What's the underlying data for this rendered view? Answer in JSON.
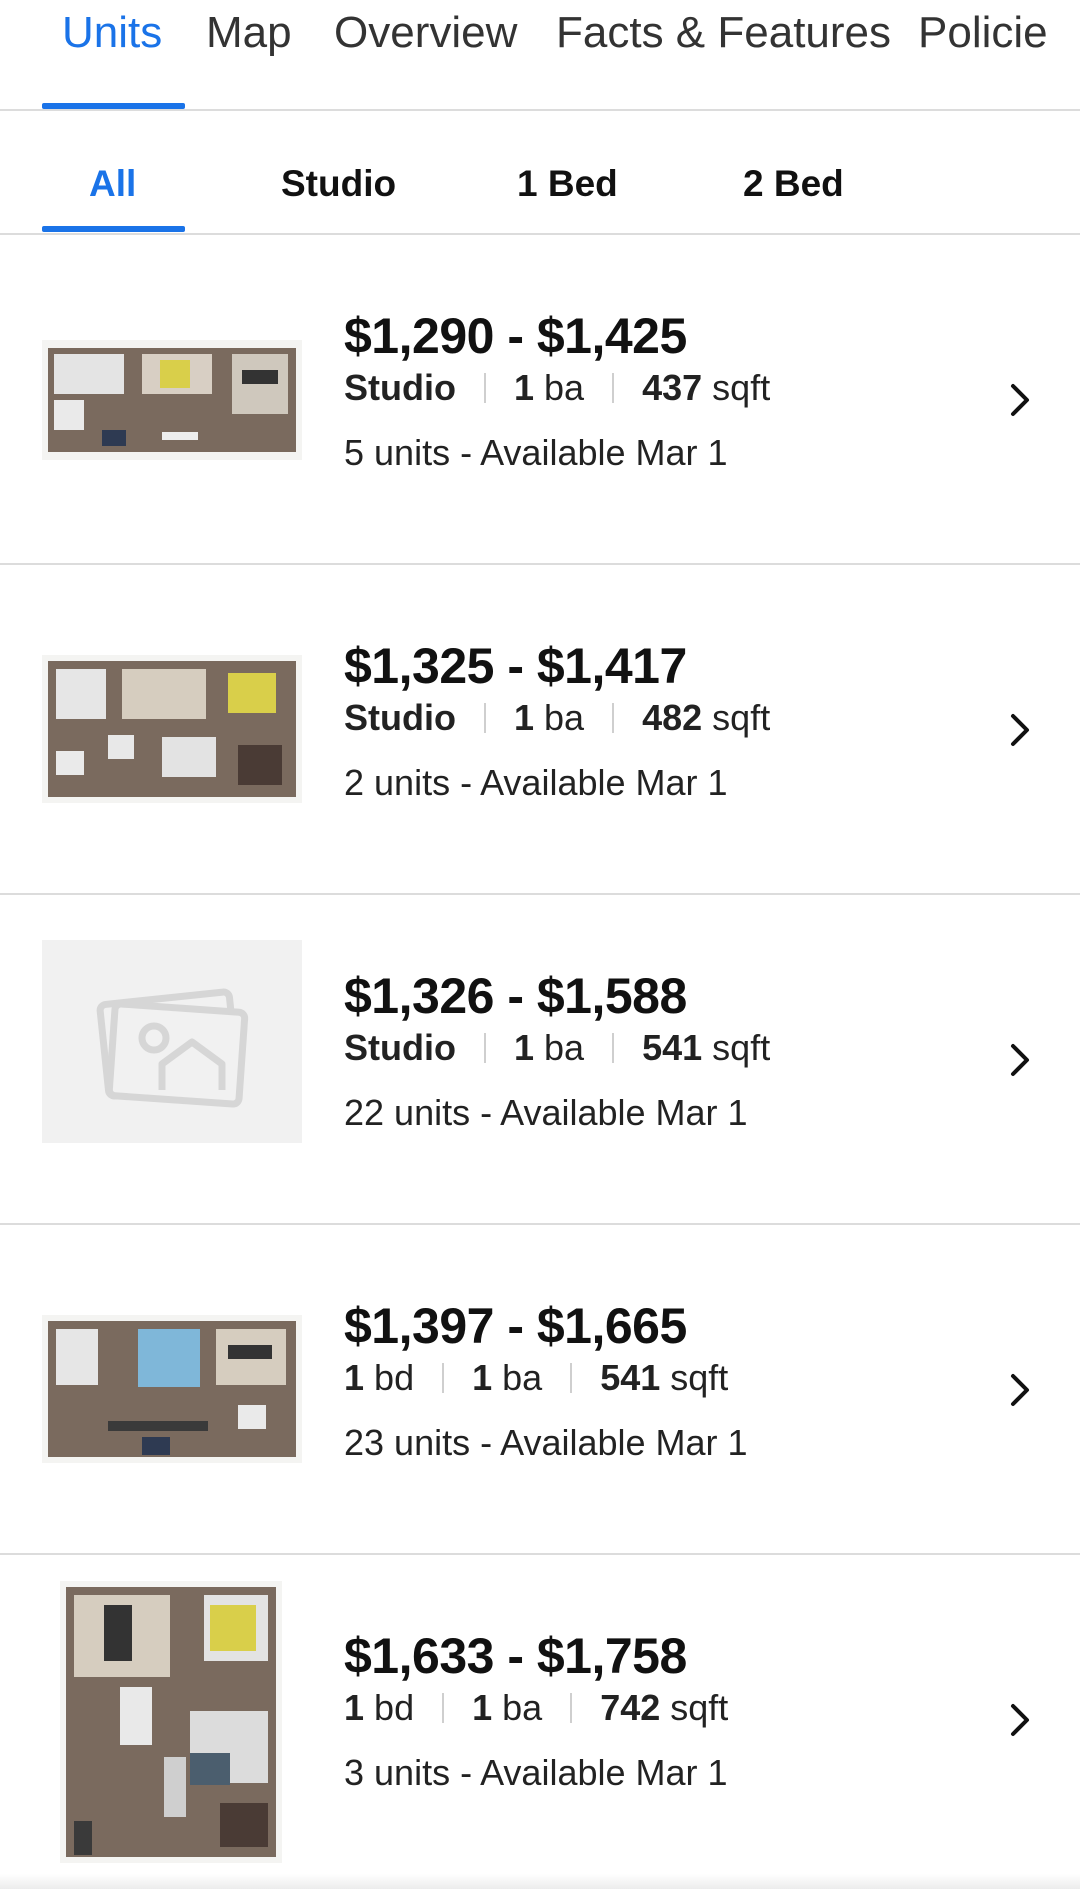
{
  "top_tabs": [
    "Units",
    "Map",
    "Overview",
    "Facts & Features",
    "Policie"
  ],
  "bed_tabs": [
    "All",
    "Studio",
    "1 Bed",
    "2 Bed"
  ],
  "colors": {
    "accent": "#1a73e8",
    "divider": "#dcdcdc",
    "text": "#111111"
  },
  "units": [
    {
      "price": "$1,290 - $1,425",
      "beds_value": "Studio",
      "beds_unit": "",
      "baths_value": "1",
      "baths_unit": "ba",
      "sqft_value": "437",
      "sqft_unit": "sqft",
      "availability": "5 units - Available Mar 1",
      "thumbnail": "floorplan"
    },
    {
      "price": "$1,325 - $1,417",
      "beds_value": "Studio",
      "beds_unit": "",
      "baths_value": "1",
      "baths_unit": "ba",
      "sqft_value": "482",
      "sqft_unit": "sqft",
      "availability": "2 units - Available Mar 1",
      "thumbnail": "floorplan"
    },
    {
      "price": "$1,326 - $1,588",
      "beds_value": "Studio",
      "beds_unit": "",
      "baths_value": "1",
      "baths_unit": "ba",
      "sqft_value": "541",
      "sqft_unit": "sqft",
      "availability": "22 units - Available Mar 1",
      "thumbnail": "image-placeholder-icon"
    },
    {
      "price": "$1,397 - $1,665",
      "beds_value": "1",
      "beds_unit": "bd",
      "baths_value": "1",
      "baths_unit": "ba",
      "sqft_value": "541",
      "sqft_unit": "sqft",
      "availability": "23 units - Available Mar 1",
      "thumbnail": "floorplan"
    },
    {
      "price": "$1,633 - $1,758",
      "beds_value": "1",
      "beds_unit": "bd",
      "baths_value": "1",
      "baths_unit": "ba",
      "sqft_value": "742",
      "sqft_unit": "sqft",
      "availability": "3 units - Available Mar 1",
      "thumbnail": "floorplan"
    }
  ],
  "icons": {
    "row_action": "chevron-right-icon",
    "placeholder": "image-placeholder-icon"
  }
}
